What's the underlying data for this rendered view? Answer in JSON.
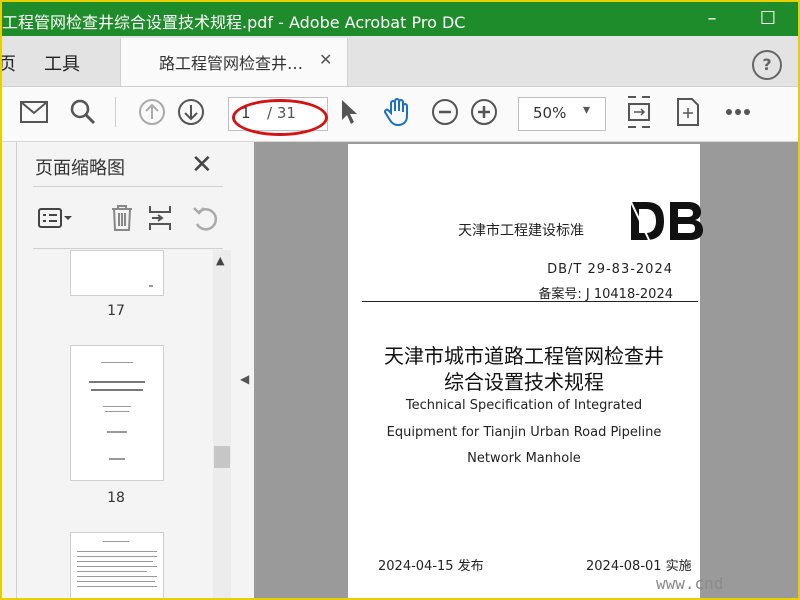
{
  "window": {
    "title": "工程管网检查井综合设置技术规程.pdf - Adobe Acrobat Pro DC"
  },
  "menubar": {
    "items": [
      "页",
      "工具"
    ],
    "tab_label": "路工程管网检查井…"
  },
  "toolbar": {
    "page_current": "1",
    "page_total": "/ 31",
    "zoom": "50%"
  },
  "sidebar": {
    "title": "页面缩略图",
    "thumbnails": [
      {
        "number": "17"
      },
      {
        "number": "18"
      }
    ]
  },
  "document": {
    "issuer": "天津市工程建设标准",
    "logo_text": "DB",
    "standard_number": "DB/T 29-83-2024",
    "record_number": "备案号: J 10418-2024",
    "title_cn_line1": "天津市城市道路工程管网检查井",
    "title_cn_line2": "综合设置技术规程",
    "title_en_line1": "Technical Specification of Integrated",
    "title_en_line2": "Equipment for Tianjin Urban Road Pipeline",
    "title_en_line3": "Network Manhole",
    "release": "2024-04-15 发布",
    "implement": "2024-08-01 实施"
  },
  "watermark": "www.cnd",
  "colors": {
    "titlebar": "#1e8c2a",
    "highlight_ellipse": "#d41414",
    "frame_border": "#e6d000"
  },
  "icons": [
    "mail-icon",
    "search-icon",
    "page-up-icon",
    "page-down-icon",
    "select-arrow-icon",
    "hand-tool-icon",
    "zoom-out-icon",
    "zoom-in-icon",
    "fit-page-icon",
    "rotate-page-icon",
    "more-icon",
    "options-icon",
    "trash-icon",
    "insert-page-icon",
    "undo-icon",
    "help-icon",
    "close-icon"
  ]
}
